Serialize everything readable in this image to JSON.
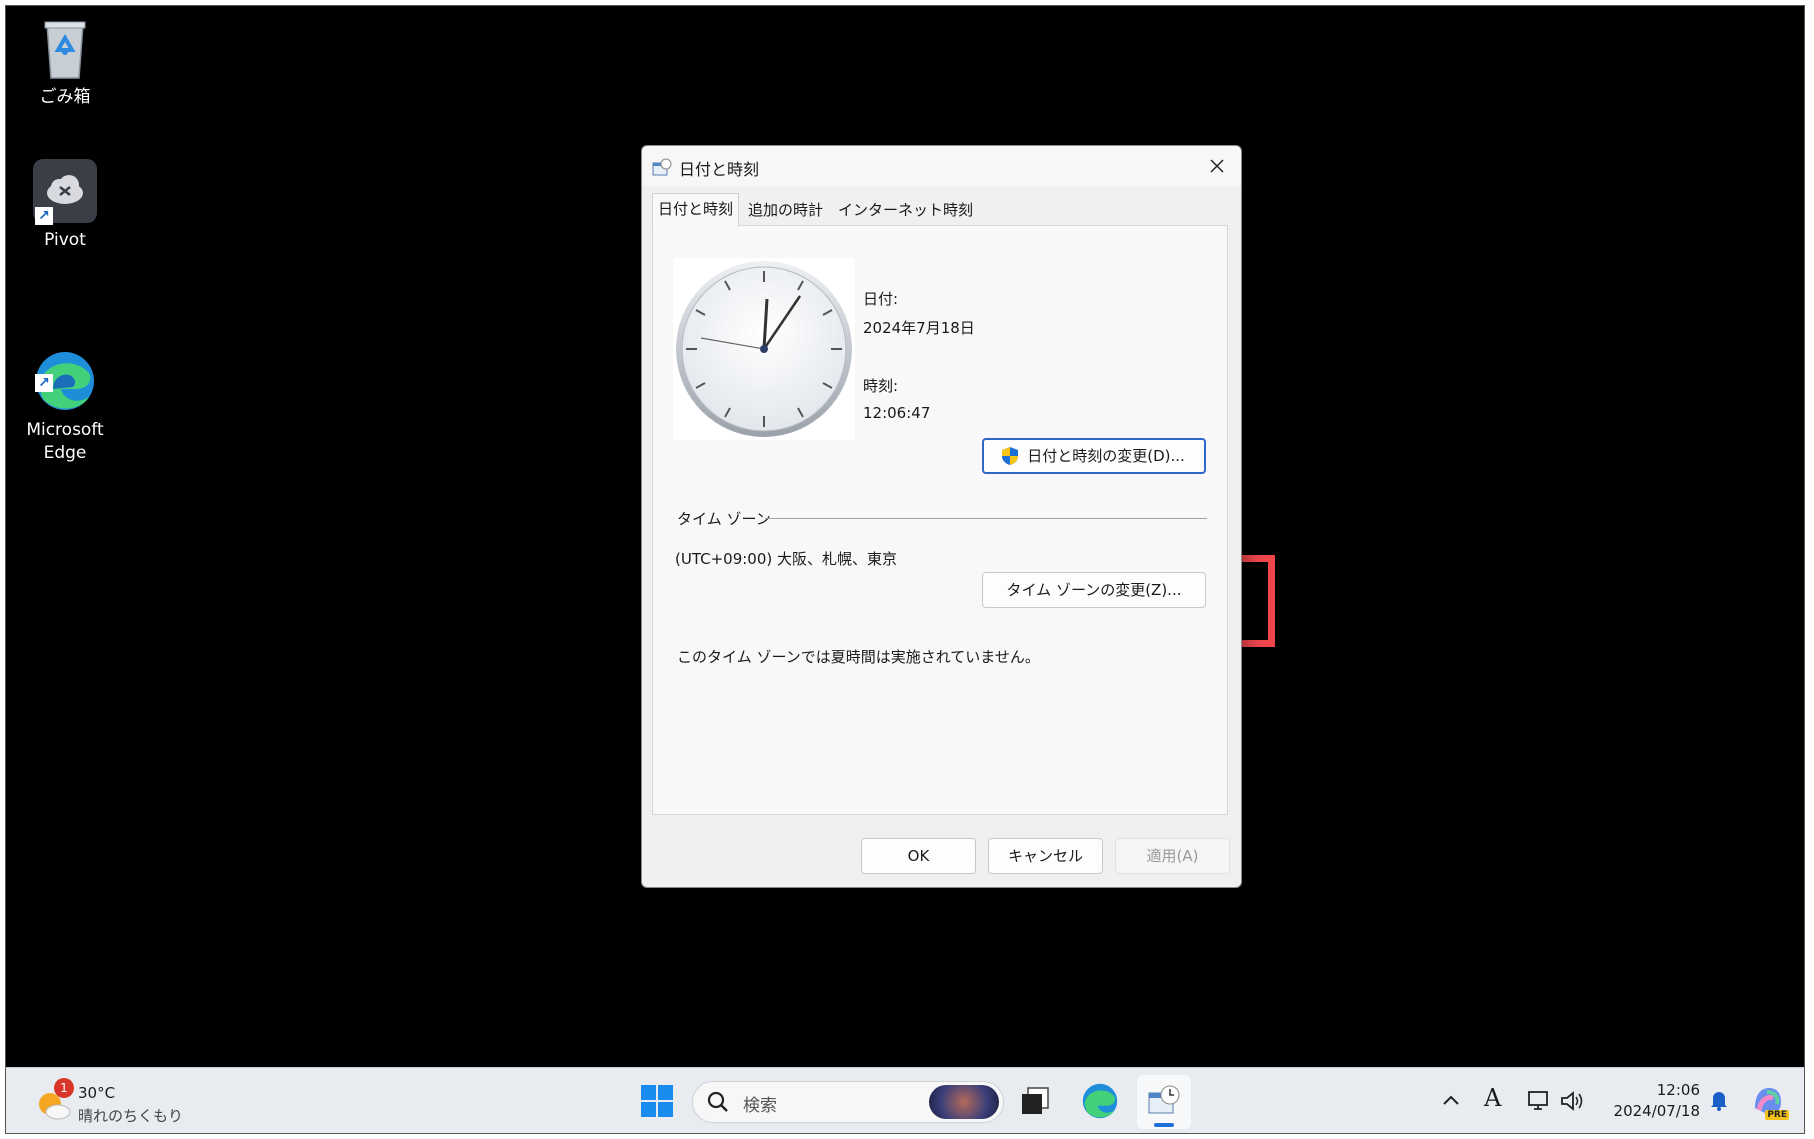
{
  "desktop": {
    "icons": [
      {
        "label": "ごみ箱"
      },
      {
        "label": "Pivot"
      },
      {
        "label": "Microsoft\nEdge"
      }
    ]
  },
  "dialog": {
    "title": "日付と時刻",
    "close_label": "✕",
    "tabs": [
      "日付と時刻",
      "追加の時計",
      "インターネット時刻"
    ],
    "date_label": "日付:",
    "date_value": "2024年7月18日",
    "time_label": "時刻:",
    "time_value": "12:06:47",
    "change_datetime_button": "日付と時刻の変更(D)...",
    "timezone_section_label": "タイム ゾーン",
    "timezone_value": "(UTC+09:00) 大阪、札幌、東京",
    "change_timezone_button": "タイム ゾーンの変更(Z)...",
    "dst_note": "このタイム ゾーンでは夏時間は実施されていません。",
    "ok_button": "OK",
    "cancel_button": "キャンセル",
    "apply_button": "適用(A)"
  },
  "taskbar": {
    "weather_temp": "30°C",
    "weather_desc": "晴れのちくもり",
    "weather_badge": "1",
    "search_placeholder": "検索",
    "clock_time": "12:06",
    "clock_date": "2024/07/18",
    "ime_indicator": "A",
    "copilot_badge": "PRE"
  },
  "colors": {
    "highlight": "#f0474d",
    "primary_button_border": "#2f67c9",
    "desktop_bg": "#000000"
  }
}
